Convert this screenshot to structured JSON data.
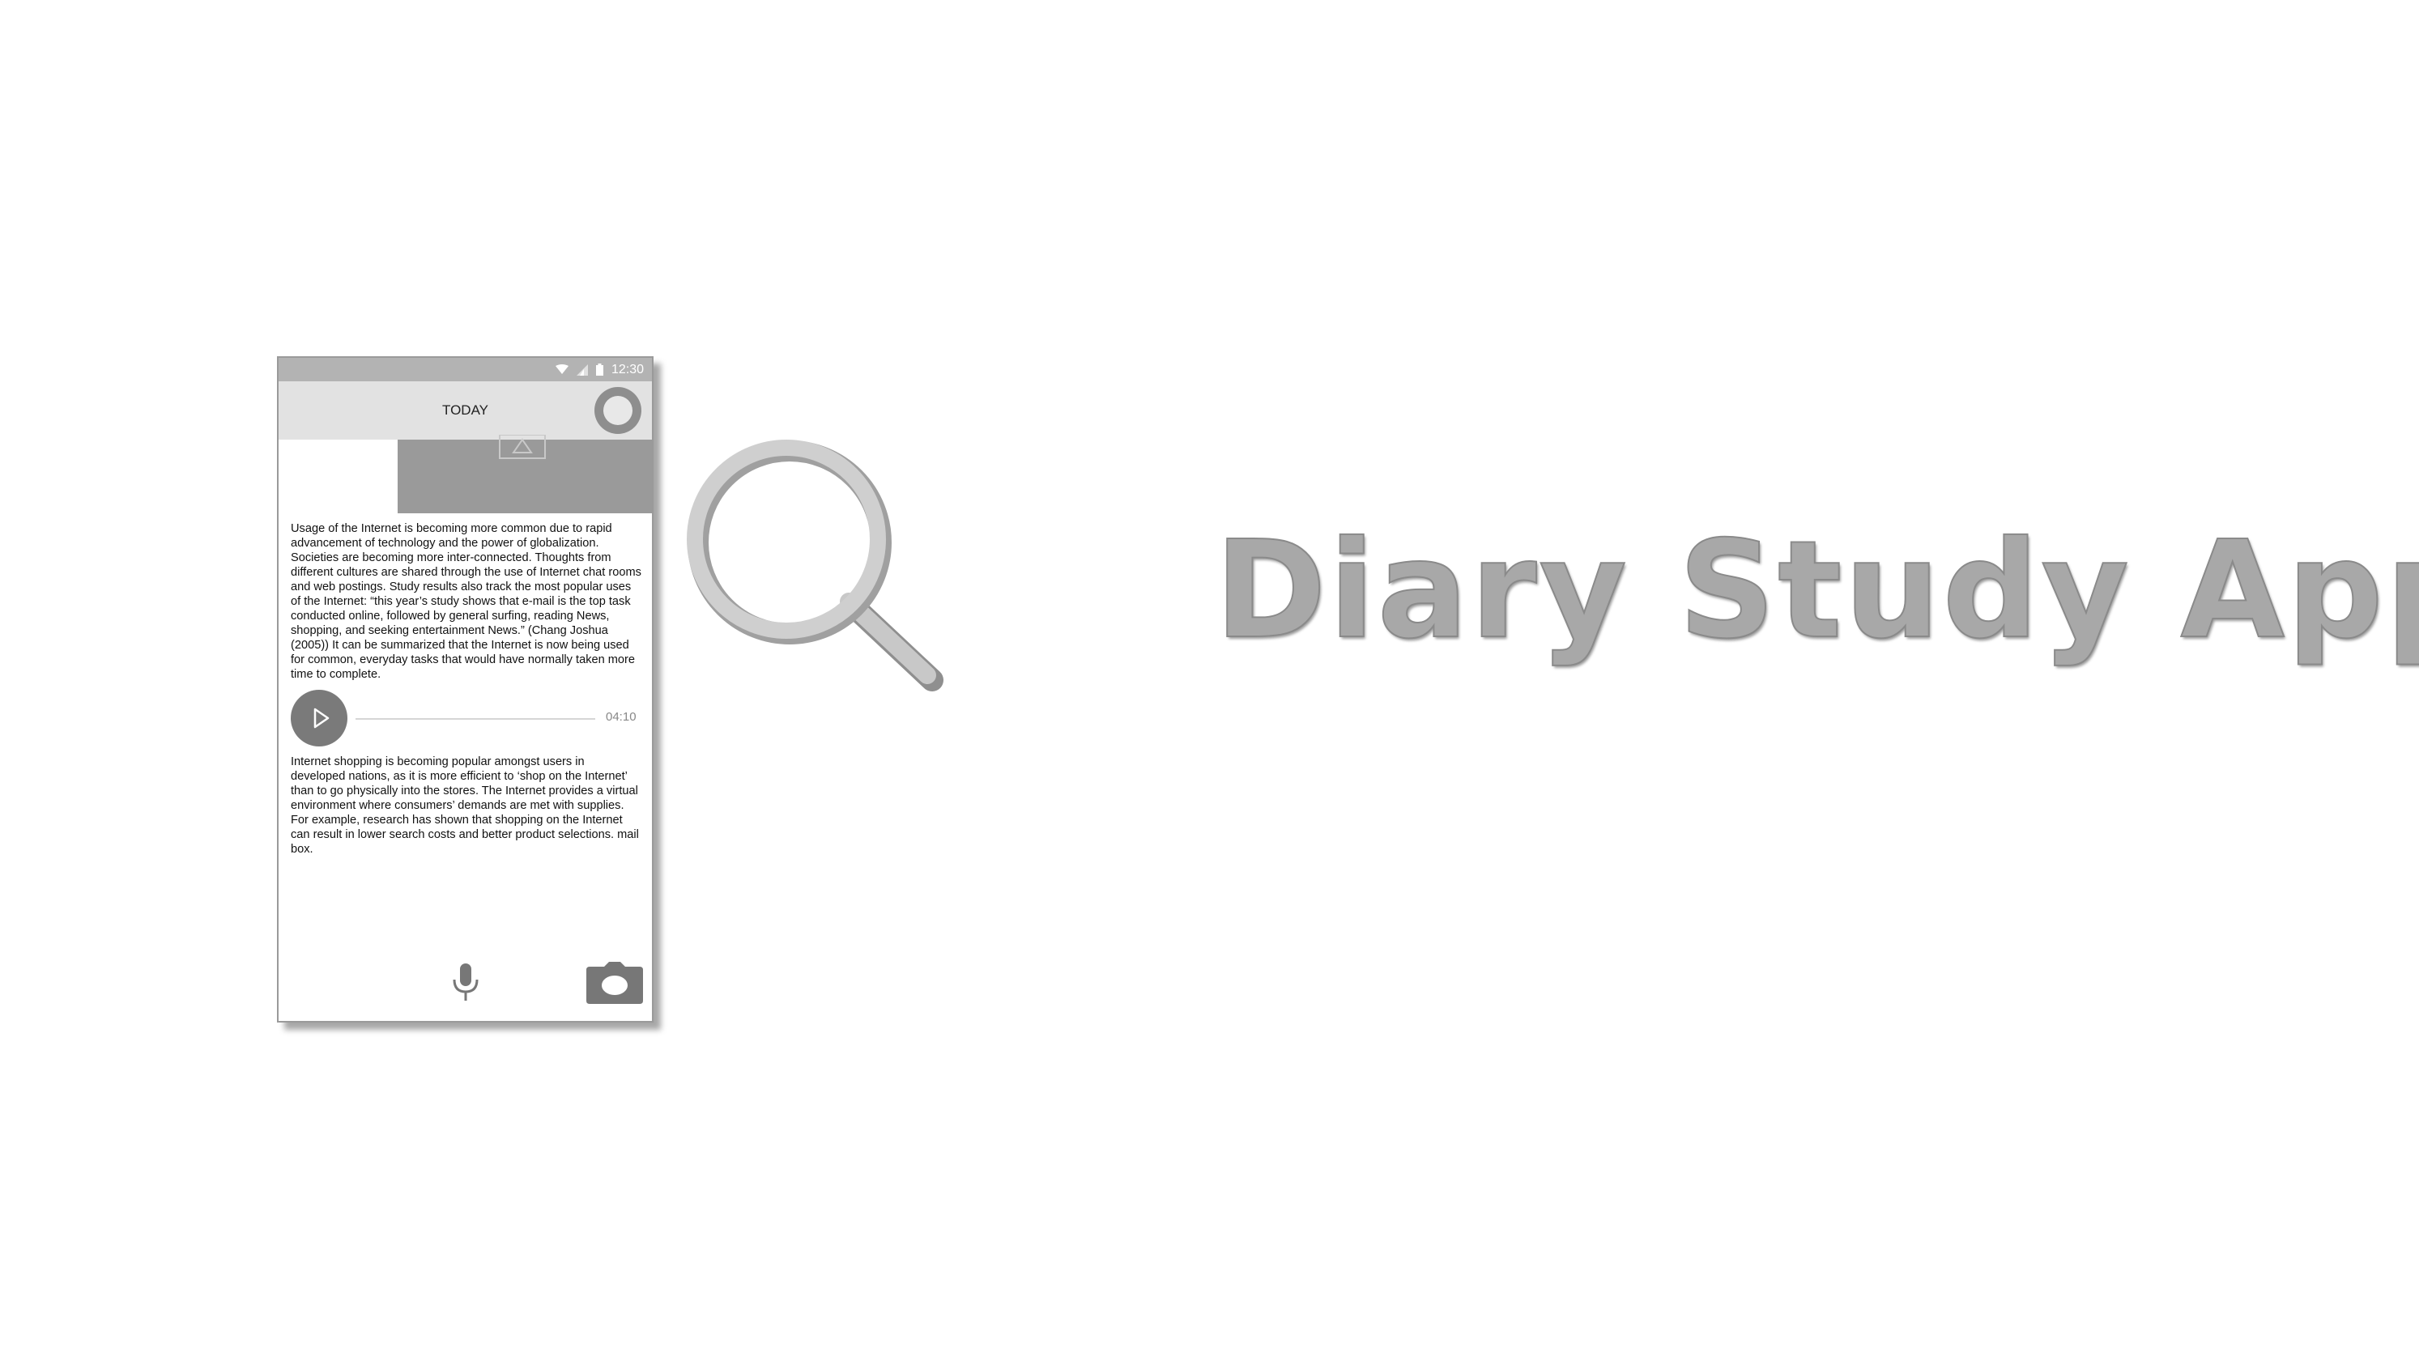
{
  "colors": {
    "status_bar": "#b3b3b3",
    "app_bar": "#e2e2e2",
    "image_placeholder": "#9a9a9a",
    "headline": "#a8a8a8"
  },
  "status_bar": {
    "icons": [
      "wifi-icon",
      "signal-icon",
      "battery-icon"
    ],
    "time": "12:30"
  },
  "app_bar": {
    "title": "TODAY",
    "action_icon": "circle-button-icon"
  },
  "entry": {
    "image_icon": "image-placeholder-icon",
    "paragraph_1": "Usage of the Internet is becoming more common due to rapid advancement of technology and the power of globalization. Societies are becoming more inter-connected. Thoughts from different cultures are shared through the use of Internet chat rooms and web postings. Study results also track the most popular uses of the Internet: “this year’s study shows that e-mail is the top task conducted online, followed by general surfing, reading News, shopping, and seeking entertainment News.” (Chang Joshua (2005)) It can be summarized that the Internet is now being used for common, everyday tasks that would have normally taken more time to complete.",
    "audio": {
      "play_icon": "play-icon",
      "duration": "04:10"
    },
    "paragraph_2": "Internet shopping is becoming popular amongst users in developed nations, as it is more efficient to ‘shop on the Internet’ than to go physically into the stores. The Internet provides a virtual environment where consumers’ demands are met with supplies. For example, research has shown that shopping on the Internet can result in lower search costs and better product selections. mail box."
  },
  "bottom_actions": {
    "mic_icon": "microphone-icon",
    "camera_icon": "camera-icon"
  },
  "decoration": {
    "search_icon": "magnifying-glass-icon"
  },
  "headline": "Diary Study App"
}
